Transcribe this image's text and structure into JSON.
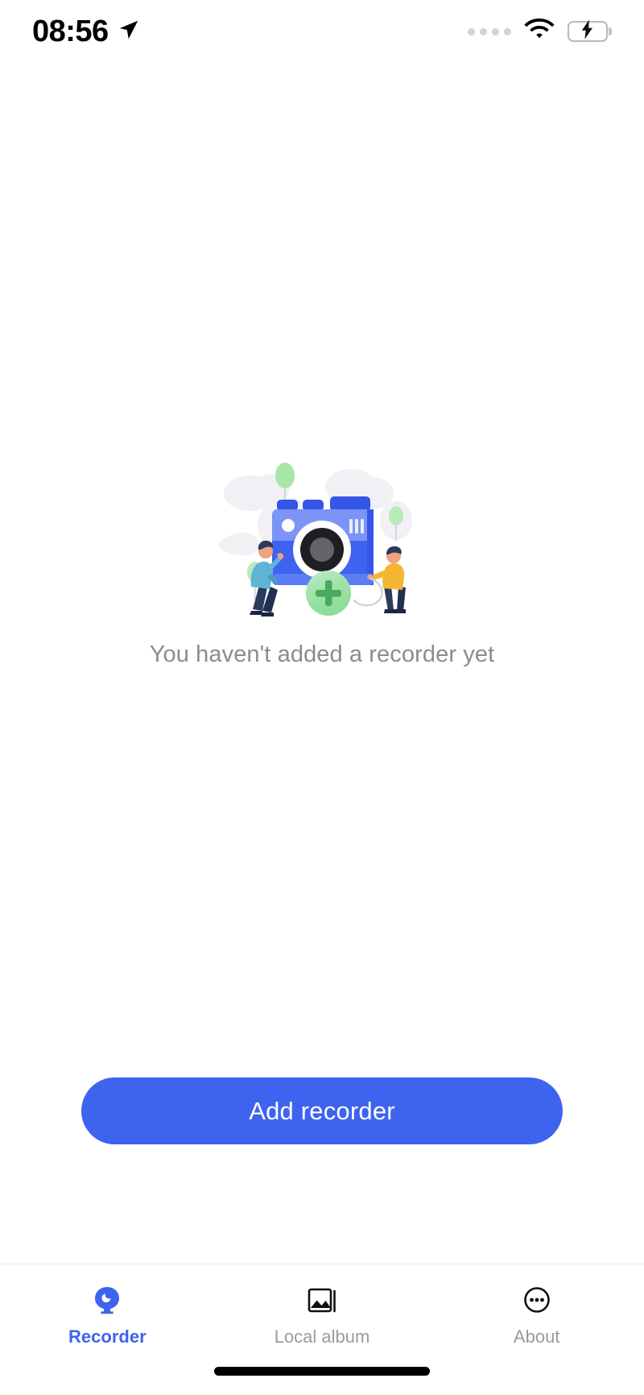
{
  "status_bar": {
    "time": "08:56",
    "location_icon": "location-arrow-icon",
    "cellular_icon": "cellular-dots-icon",
    "cellular_dots": 4,
    "wifi_icon": "wifi-icon",
    "battery_icon": "battery-charging-icon",
    "battery_color": "#4ad45f"
  },
  "empty_state": {
    "illustration": "camera-add-illustration",
    "message": "You haven't added a recorder yet",
    "message_color": "#8b8b90",
    "camera_body_color": "#3e63ef",
    "camera_top_color": "#4a6ef2",
    "badge_icon": "plus-icon",
    "badge_color": "#7fd98e"
  },
  "primary_action": {
    "label": "Add recorder",
    "color": "#3e63ef",
    "text_color": "#ffffff"
  },
  "tab_bar": {
    "active_color": "#3e63ef",
    "inactive_color": "#9a9aa0",
    "items": [
      {
        "label": "Recorder",
        "icon": "recorder-camera-icon",
        "active": true
      },
      {
        "label": "Local album",
        "icon": "image-frame-icon",
        "active": false
      },
      {
        "label": "About",
        "icon": "ellipsis-circle-icon",
        "active": false
      }
    ]
  },
  "home_indicator": "home-indicator"
}
